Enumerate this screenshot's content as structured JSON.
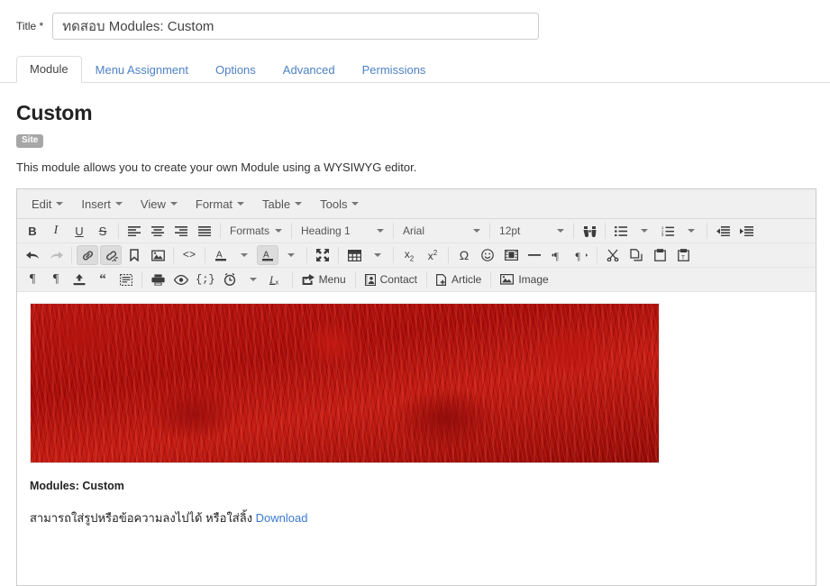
{
  "form": {
    "title_label": "Title *",
    "title_value": "ทดสอบ Modules: Custom",
    "title_placeholder": "Title"
  },
  "tabs": [
    {
      "label": "Module",
      "active": true
    },
    {
      "label": "Menu Assignment",
      "active": false
    },
    {
      "label": "Options",
      "active": false
    },
    {
      "label": "Advanced",
      "active": false
    },
    {
      "label": "Permissions",
      "active": false
    }
  ],
  "module": {
    "heading": "Custom",
    "badge": "Site",
    "description": "This module allows you to create your own Module using a WYSIWYG editor."
  },
  "editor": {
    "menubar": [
      {
        "label": "Edit"
      },
      {
        "label": "Insert"
      },
      {
        "label": "View"
      },
      {
        "label": "Format"
      },
      {
        "label": "Table"
      },
      {
        "label": "Tools"
      }
    ],
    "toolbar_row1": {
      "bold": "B",
      "italic": "I",
      "underline": "U",
      "strikethrough": "S",
      "align_left": "align-left-icon",
      "align_center": "align-center-icon",
      "align_right": "align-right-icon",
      "align_justify": "align-justify-icon",
      "formats_label": "Formats",
      "block_label": "Heading 1",
      "font_label": "Arial",
      "size_label": "12pt",
      "searchreplace": "binoculars-icon",
      "bullist": "bulleted-list-icon",
      "numlist": "numbered-list-icon",
      "outdent": "outdent-icon",
      "indent": "indent-icon"
    },
    "toolbar_row2": {
      "undo": "undo-icon",
      "redo": "redo-icon",
      "link": "link-icon",
      "unlink": "unlink-icon",
      "anchor": "anchor-bookmark-icon",
      "image": "image-icon",
      "sourcecode": "source-code-icon",
      "forecolor": "text-color-icon",
      "backcolor": "text-highlight-icon",
      "fullscreen": "fullscreen-icon",
      "table": "table-icon",
      "subscript": "subscript-icon",
      "superscript": "superscript-icon",
      "charmap": "special-character-icon",
      "emoticons": "emoticon-icon",
      "media": "media-icon",
      "hr": "horizontal-rule-icon",
      "ltr": "ltr-icon",
      "rtl": "rtl-icon",
      "cut": "scissors-icon",
      "copy": "copy-icon",
      "paste": "paste-icon",
      "pastetext": "paste-text-icon"
    },
    "toolbar_row3": {
      "visualchars": "paragraph-mark-icon",
      "pilcrow": "pilcrow-icon",
      "insertfile": "upload-icon",
      "blockquote": "blockquote-icon",
      "visualblocks": "visual-blocks-icon",
      "print": "print-icon",
      "preview": "eye-preview-icon",
      "template": "code-sample-icon",
      "insertdatetime": "clock-icon",
      "removeformat": "remove-format-icon",
      "menu_label": "Menu",
      "contact_label": "Contact",
      "article_label": "Article",
      "image_label": "Image"
    }
  },
  "content": {
    "image_alt": "red-japanese-maple-foliage",
    "caption": "Modules: Custom",
    "paragraph_text": "สามารถใส่รูปหรือข้อความลงไปได้ หรือใส่ลิ้ง ",
    "link_text": "Download"
  },
  "colors": {
    "link": "#3b7ad0",
    "tab_link": "#4e82c4",
    "badge_bg": "#a6a6a6",
    "toolbar_bg": "#f0f0f0",
    "border": "#cccccc"
  }
}
